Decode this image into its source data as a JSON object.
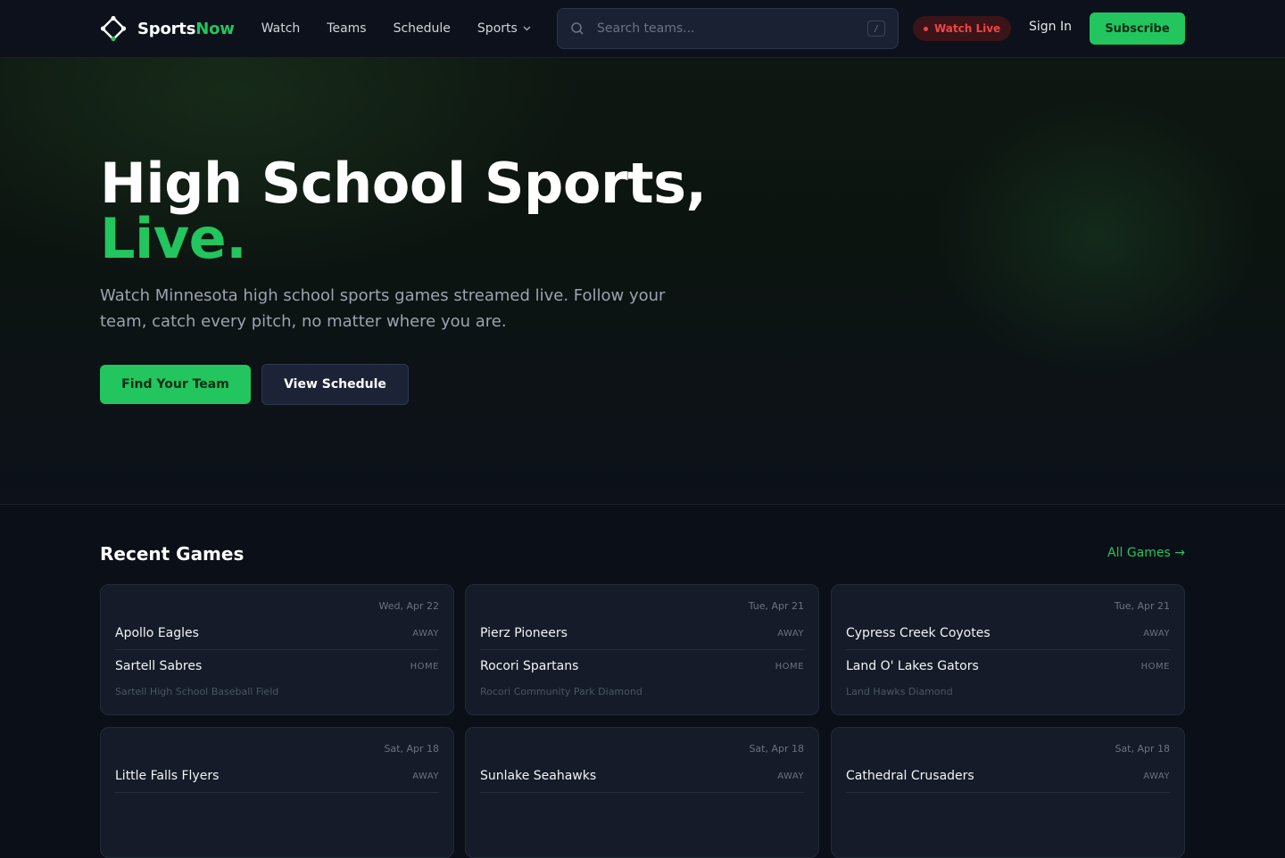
{
  "nav": {
    "brand_primary": "Sports",
    "brand_accent": "Now",
    "links": [
      {
        "label": "Watch"
      },
      {
        "label": "Teams"
      },
      {
        "label": "Schedule"
      },
      {
        "label": "Sports",
        "has_dropdown": true
      }
    ],
    "search": {
      "placeholder": "Search teams...",
      "value": "",
      "shortcut": "/"
    },
    "live_label": "Watch Live",
    "signin_label": "Sign In",
    "subscribe_label": "Subscribe"
  },
  "hero": {
    "title_line1": "High School Sports,",
    "title_line2": "Live.",
    "subtitle": "Watch Minnesota high school sports games streamed live. Follow your team, catch every pitch, no matter where you are.",
    "primary_cta": "Find Your Team",
    "secondary_cta": "View Schedule"
  },
  "recent": {
    "title": "Recent Games",
    "all_link": "All Games →",
    "away_tag": "AWAY",
    "home_tag": "HOME",
    "games": [
      {
        "date": "Wed, Apr 22",
        "away": "Apollo Eagles",
        "home": "Sartell Sabres",
        "venue": "Sartell High School Baseball Field"
      },
      {
        "date": "Tue, Apr 21",
        "away": "Pierz Pioneers",
        "home": "Rocori Spartans",
        "venue": "Rocori Community Park Diamond"
      },
      {
        "date": "Tue, Apr 21",
        "away": "Cypress Creek Coyotes",
        "home": "Land O' Lakes Gators",
        "venue": "Land Hawks Diamond"
      },
      {
        "date": "Sat, Apr 18",
        "away": "Little Falls Flyers",
        "home": "",
        "venue": ""
      },
      {
        "date": "Sat, Apr 18",
        "away": "Sunlake Seahawks",
        "home": "",
        "venue": ""
      },
      {
        "date": "Sat, Apr 18",
        "away": "Cathedral Crusaders",
        "home": "",
        "venue": ""
      }
    ]
  },
  "colors": {
    "accent": "#22c55e",
    "live": "#ef4444",
    "background": "#0b0f17",
    "card": "#151b28"
  },
  "icons": [
    "logo-diamond-icon",
    "search-icon",
    "chevron-down-icon",
    "live-dot-icon"
  ]
}
